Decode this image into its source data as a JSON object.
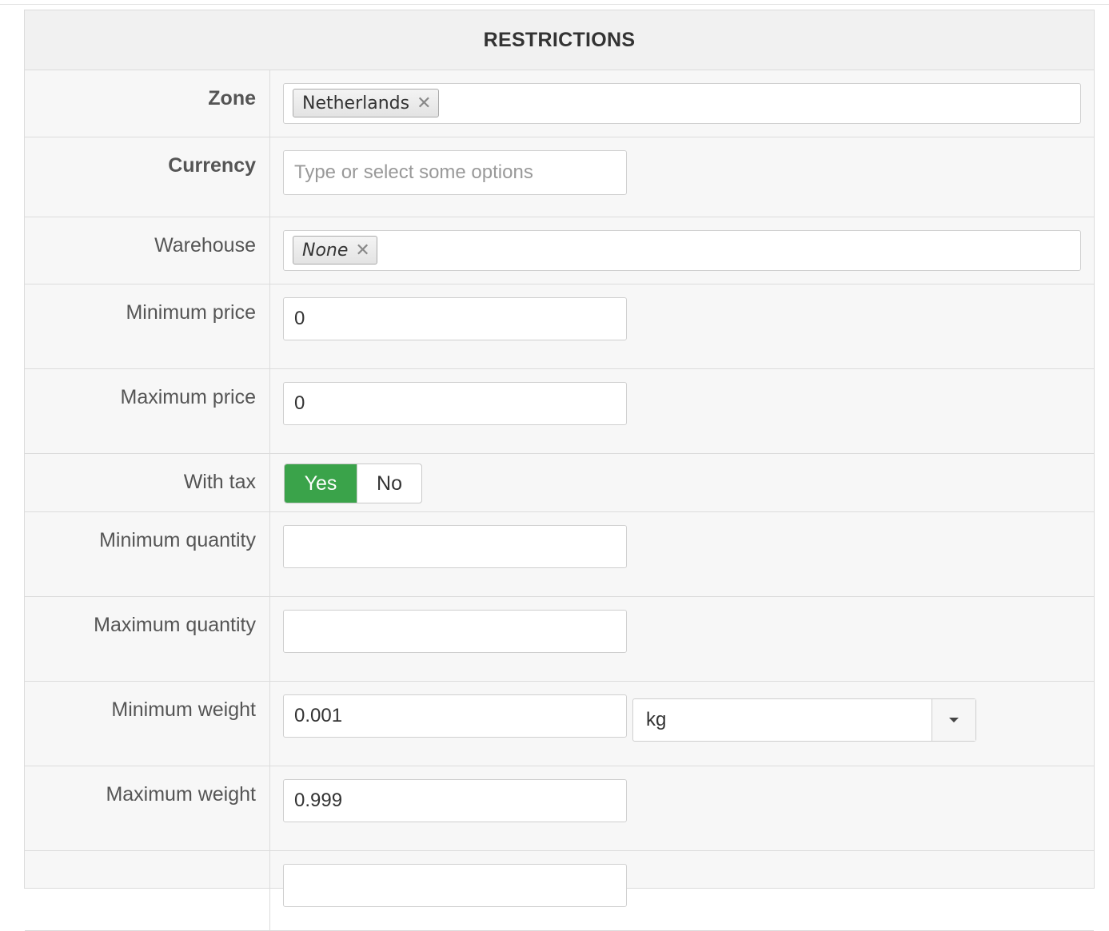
{
  "panel": {
    "title": "RESTRICTIONS"
  },
  "rows": {
    "zone": {
      "label": "Zone",
      "tags": [
        "Netherlands"
      ]
    },
    "currency": {
      "label": "Currency",
      "placeholder": "Type or select some options"
    },
    "warehouse": {
      "label": "Warehouse",
      "tags": [
        "None"
      ]
    },
    "min_price": {
      "label": "Minimum price",
      "value": "0"
    },
    "max_price": {
      "label": "Maximum price",
      "value": "0"
    },
    "with_tax": {
      "label": "With tax",
      "yes_label": "Yes",
      "no_label": "No",
      "selected": "Yes"
    },
    "min_qty": {
      "label": "Minimum quantity",
      "value": ""
    },
    "max_qty": {
      "label": "Maximum quantity",
      "value": ""
    },
    "min_weight": {
      "label": "Minimum weight",
      "value": "0.001",
      "unit": "kg"
    },
    "max_weight": {
      "label": "Maximum weight",
      "value": "0.999"
    }
  },
  "icons": {
    "tag_remove": "close-icon",
    "dropdown": "caret-down-icon"
  },
  "colors": {
    "switch_active": "#3aa34a"
  }
}
